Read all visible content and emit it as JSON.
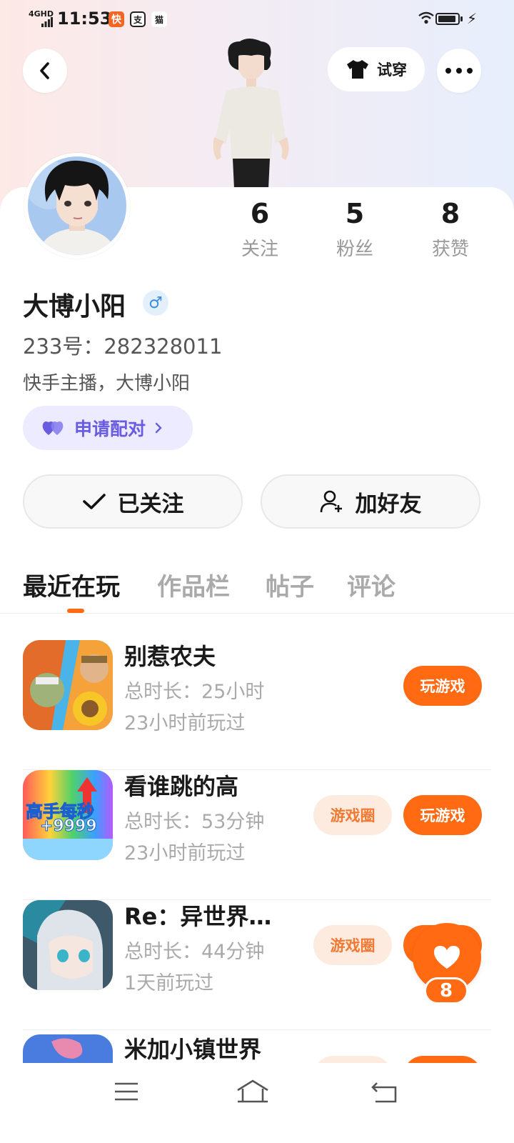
{
  "status_bar": {
    "network": "4GHD",
    "time": "11:53",
    "app_icons": [
      "快",
      "支",
      "猫"
    ]
  },
  "header": {
    "back_icon": "chevron-left-icon",
    "try_on_label": "试穿",
    "more_icon": "more-icon"
  },
  "profile": {
    "name": "大博小阳",
    "gender_symbol": "♂",
    "uid": "233号：282328011",
    "bio": "快手主播，大博小阳",
    "match_label": "申请配对",
    "stats": [
      {
        "value": "6",
        "label": "关注"
      },
      {
        "value": "5",
        "label": "粉丝"
      },
      {
        "value": "8",
        "label": "获赞"
      }
    ]
  },
  "actions": {
    "followed_label": "已关注",
    "add_friend_label": "加好友"
  },
  "tabs": [
    {
      "label": "最近在玩",
      "active": true
    },
    {
      "label": "作品栏",
      "active": false
    },
    {
      "label": "帖子",
      "active": false
    },
    {
      "label": "评论",
      "active": false
    }
  ],
  "games": [
    {
      "title": "别惹农夫",
      "duration": "总时长：25小时",
      "last_played": "23小时前玩过",
      "circle_label": "",
      "play_label": "玩游戏"
    },
    {
      "title": "看谁跳的高",
      "duration": "总时长：53分钟",
      "last_played": "23小时前玩过",
      "circle_label": "游戏圈",
      "play_label": "玩游戏",
      "icon_text_1": "高手每秒",
      "icon_text_2": "+9999"
    },
    {
      "title": "Re：异世界…",
      "duration": "总时长：44分钟",
      "last_played": "1天前玩过",
      "circle_label": "游戏圈",
      "play_label": "玩游戏"
    },
    {
      "title": "米加小镇世界",
      "duration": "",
      "last_played": "",
      "circle_label": "",
      "play_label": ""
    }
  ],
  "float_like": {
    "count": "8"
  },
  "colors": {
    "accent": "#ff6a13",
    "match": "#6a5ce0",
    "gender": "#3c8ddc"
  }
}
